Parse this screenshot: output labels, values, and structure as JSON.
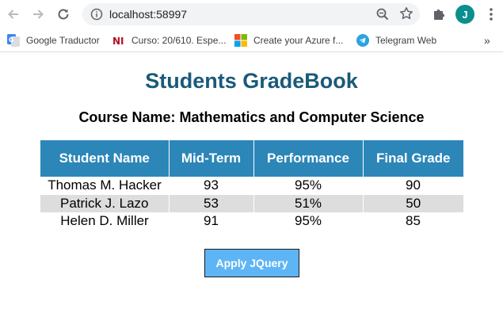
{
  "browser": {
    "url": "localhost:58997",
    "avatar_letter": "J",
    "bookmarks": [
      {
        "label": "Google Traductor",
        "icon": "google-translate-icon"
      },
      {
        "label": "Curso: 20/610. Espe...",
        "icon": "ni-logo-icon"
      },
      {
        "label": "Create your Azure f...",
        "icon": "microsoft-logo-icon"
      },
      {
        "label": "Telegram Web",
        "icon": "telegram-icon"
      }
    ],
    "more_bookmarks": "»"
  },
  "page": {
    "title": "Students GradeBook",
    "course": "Course Name: Mathematics and Computer Science",
    "columns": [
      "Student Name",
      "Mid-Term",
      "Performance",
      "Final Grade"
    ],
    "rows": [
      [
        "Thomas M. Hacker",
        "93",
        "95%",
        "90"
      ],
      [
        "Patrick J. Lazo",
        "53",
        "51%",
        "50"
      ],
      [
        "Helen D. Miller",
        "91",
        "95%",
        "85"
      ]
    ],
    "apply_button": "Apply JQuery"
  },
  "colors": {
    "title": "#1a5a78",
    "header_bg": "#2c86b8",
    "alt_row_bg": "#dddddd",
    "button_bg": "#5eb5f5",
    "avatar_bg": "#0a8f8f"
  }
}
